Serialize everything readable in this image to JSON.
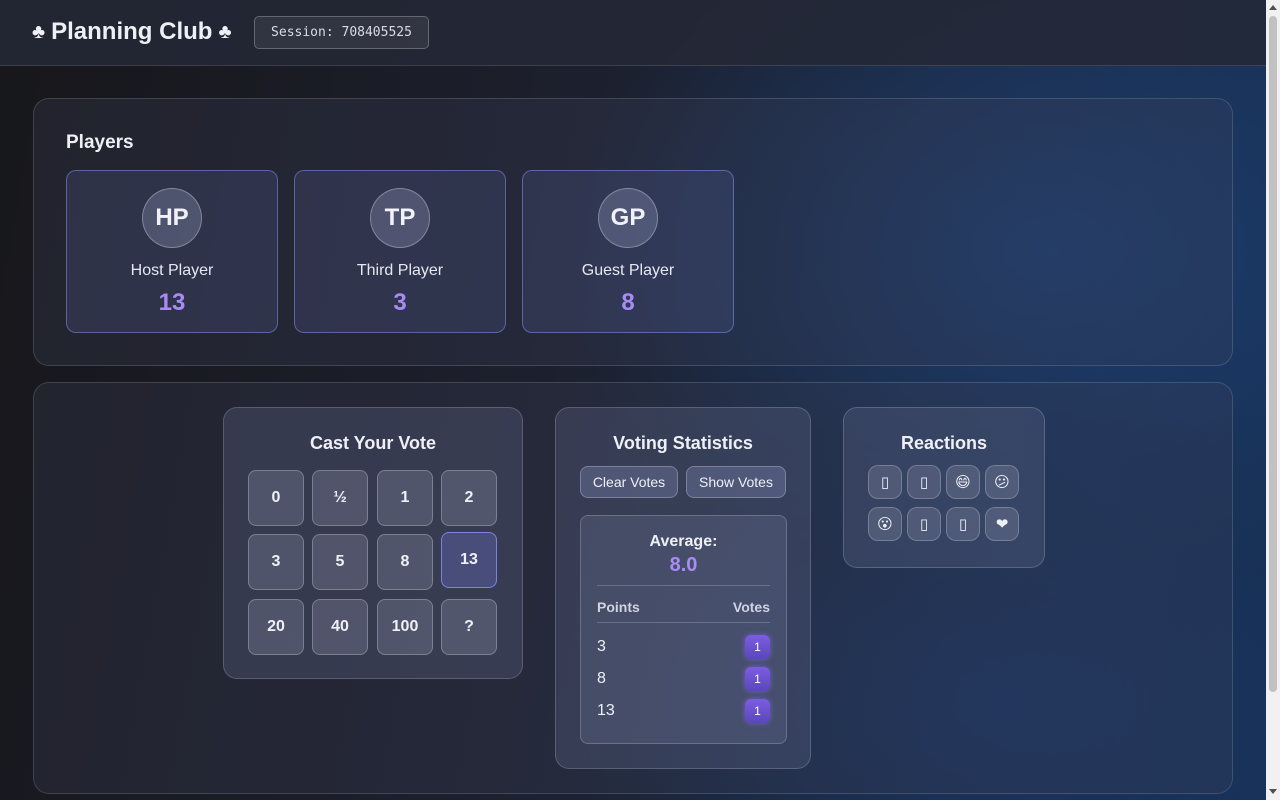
{
  "header": {
    "title": "Planning Club",
    "left_icon": "♣",
    "right_icon": "♣",
    "session_label": "Session: 708405525"
  },
  "players": {
    "heading": "Players",
    "list": [
      {
        "initials": "HP",
        "name": "Host Player",
        "vote": "13"
      },
      {
        "initials": "TP",
        "name": "Third Player",
        "vote": "3"
      },
      {
        "initials": "GP",
        "name": "Guest Player",
        "vote": "8"
      }
    ]
  },
  "vote": {
    "title": "Cast Your Vote",
    "cards": [
      "0",
      "½",
      "1",
      "2",
      "3",
      "5",
      "8",
      "13",
      "20",
      "40",
      "100",
      "?"
    ],
    "selected": "13"
  },
  "stats": {
    "title": "Voting Statistics",
    "clear_label": "Clear Votes",
    "show_label": "Show Votes",
    "average_label": "Average:",
    "average_value": "8.0",
    "col_points": "Points",
    "col_votes": "Votes",
    "rows": [
      {
        "points": "3",
        "votes": "1"
      },
      {
        "points": "8",
        "votes": "1"
      },
      {
        "points": "13",
        "votes": "1"
      }
    ]
  },
  "reactions": {
    "title": "Reactions",
    "items": [
      {
        "glyph": "▯",
        "icon": "missing-emoji-icon"
      },
      {
        "glyph": "▯",
        "icon": "missing-emoji-icon"
      },
      {
        "glyph": "😄",
        "icon": "grinning-face-icon"
      },
      {
        "glyph": "😕",
        "icon": "confused-face-icon"
      },
      {
        "glyph": "😮",
        "icon": "surprised-face-icon"
      },
      {
        "glyph": "▯",
        "icon": "missing-emoji-icon"
      },
      {
        "glyph": "▯",
        "icon": "missing-emoji-icon"
      },
      {
        "glyph": "❤",
        "icon": "heart-icon"
      }
    ]
  },
  "colors": {
    "accent_purple": "#a98bf5",
    "badge_purple": "#6b50d0",
    "selected_border": "#8c96ff"
  }
}
